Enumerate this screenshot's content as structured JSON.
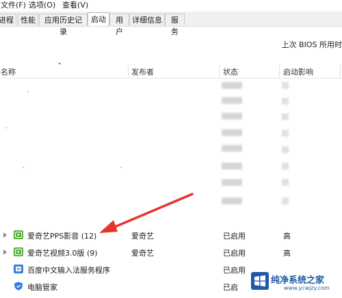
{
  "menu": [
    "文件(F)",
    "选项(O)",
    "查看(V)"
  ],
  "tabs": [
    {
      "label": "进程",
      "active": false
    },
    {
      "label": "性能",
      "active": false
    },
    {
      "label": "应用历史记录",
      "active": false
    },
    {
      "label": "启动",
      "active": true
    },
    {
      "label": "用户",
      "active": false
    },
    {
      "label": "详细信息",
      "active": false
    },
    {
      "label": "服务",
      "active": false
    }
  ],
  "bios_label": "上次 BIOS 所用时",
  "columns": {
    "name": "名称",
    "publisher": "发布者",
    "status": "状态",
    "impact": "启动影响"
  },
  "rows": [
    {
      "name": "爱奇艺PPS影音 (12)",
      "publisher": "爱奇艺",
      "status": "已启用",
      "impact": "高",
      "icon": "iqiyi-pps-icon",
      "expandable": true
    },
    {
      "name": "爱奇艺视频3.0版 (9)",
      "publisher": "爱奇艺",
      "status": "已启用",
      "impact": "高",
      "icon": "iqiyi-video-icon",
      "expandable": true
    },
    {
      "name": "百度中文输入法服务程序",
      "publisher": "",
      "status": "已启用",
      "impact": "",
      "icon": "baidu-ime-icon",
      "expandable": false
    },
    {
      "name": "电脑管家",
      "publisher": "",
      "status": "已启",
      "impact": "",
      "icon": "pc-manager-icon",
      "expandable": false
    }
  ],
  "colors": {
    "iqiyi_green": "#4cae2e",
    "annotation_red": "#e8322c",
    "logo_blue": "#1e5aa8"
  },
  "watermark": {
    "title": "纯净系统之家",
    "url": "www.ycwjzy.com"
  }
}
